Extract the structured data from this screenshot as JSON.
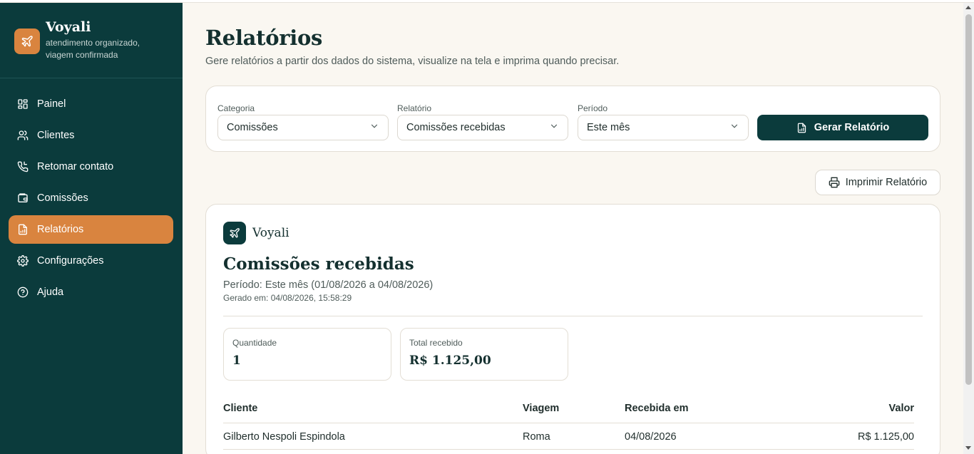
{
  "brand": {
    "name": "Voyali",
    "tagline": "atendimento organizado, viagem confirmada"
  },
  "sidebar": {
    "items": [
      {
        "label": "Painel",
        "icon": "dashboard-icon",
        "active": false
      },
      {
        "label": "Clientes",
        "icon": "users-icon",
        "active": false
      },
      {
        "label": "Retomar contato",
        "icon": "phone-icon",
        "active": false
      },
      {
        "label": "Comissões",
        "icon": "wallet-icon",
        "active": false
      },
      {
        "label": "Relatórios",
        "icon": "report-icon",
        "active": true
      },
      {
        "label": "Configurações",
        "icon": "gear-icon",
        "active": false
      },
      {
        "label": "Ajuda",
        "icon": "help-icon",
        "active": false
      }
    ]
  },
  "page": {
    "title": "Relatórios",
    "subtitle": "Gere relatórios a partir dos dados do sistema, visualize na tela e imprima quando precisar."
  },
  "filters": {
    "category": {
      "label": "Categoria",
      "value": "Comissões"
    },
    "report": {
      "label": "Relatório",
      "value": "Comissões recebidas"
    },
    "period": {
      "label": "Período",
      "value": "Este mês"
    },
    "generate_label": "Gerar Relatório"
  },
  "print_label": "Imprimir Relatório",
  "report": {
    "brand": "Voyali",
    "title": "Comissões recebidas",
    "period": "Período: Este mês (01/08/2026 a 04/08/2026)",
    "generated": "Gerado em: 04/08/2026, 15:58:29",
    "stats": [
      {
        "label": "Quantidade",
        "value": "1"
      },
      {
        "label": "Total recebido",
        "value": "R$ 1.125,00"
      }
    ],
    "table": {
      "headers": [
        "Cliente",
        "Viagem",
        "Recebida em",
        "Valor"
      ],
      "rows": [
        [
          "Gilberto Nespoli Espindola",
          "Roma",
          "04/08/2026",
          "R$ 1.125,00"
        ]
      ]
    }
  },
  "colors": {
    "primary": "#0b3b3c",
    "accent": "#d9843f",
    "background": "#faf7f1"
  }
}
